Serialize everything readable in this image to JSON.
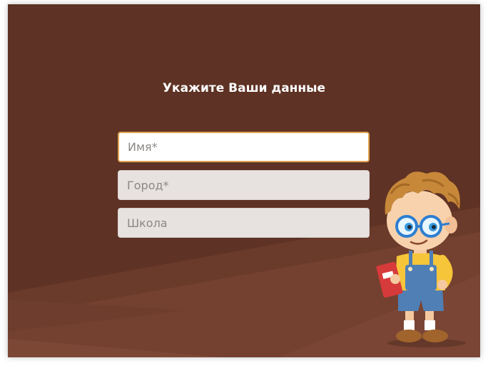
{
  "form": {
    "title": "Укажите Ваши данные",
    "fields": [
      {
        "placeholder": "Имя*",
        "value": ""
      },
      {
        "placeholder": "Город*",
        "value": ""
      },
      {
        "placeholder": "Школа",
        "value": ""
      }
    ]
  },
  "colors": {
    "background": "#5e3224",
    "field_background": "#e7e1e0",
    "active_border": "#e0a451",
    "title": "#ffffff"
  },
  "icons": {
    "mascot": "schoolboy-mascot-icon"
  }
}
